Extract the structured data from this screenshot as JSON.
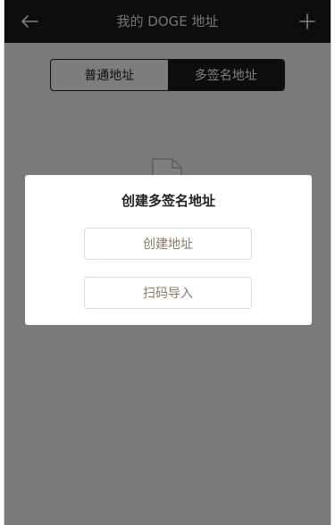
{
  "nav": {
    "title": "我的 DOGE 地址",
    "back_icon": "arrow-left-icon",
    "add_icon": "plus-icon"
  },
  "tabs": [
    {
      "label": "普通地址",
      "active": false
    },
    {
      "label": "多签名地址",
      "active": true
    }
  ],
  "dialog": {
    "title": "创建多签名地址",
    "create_label": "创建地址",
    "scan_label": "扫码导入"
  },
  "colors": {
    "nav_bg": "#1a1a1a",
    "overlay": "rgba(0,0,0,0.5)",
    "button_text": "#8a7a66"
  }
}
